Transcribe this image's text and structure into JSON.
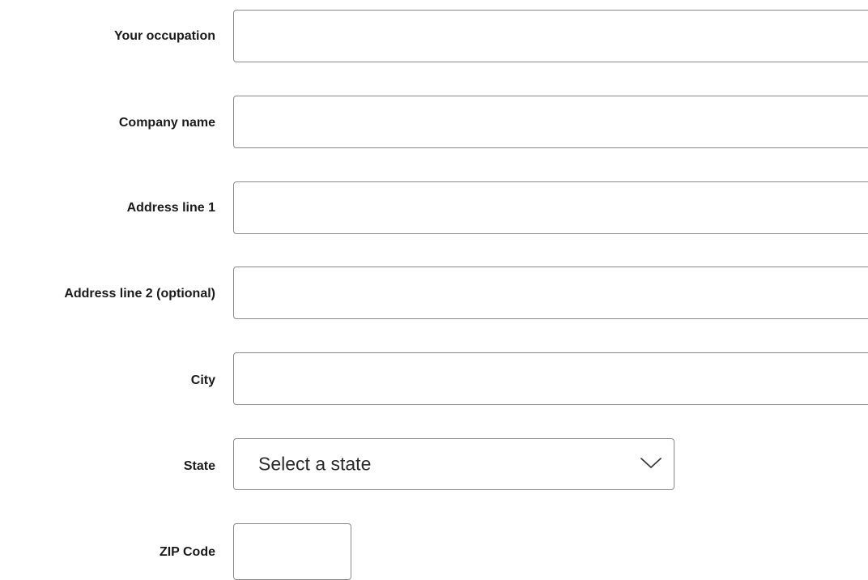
{
  "form": {
    "occupation": {
      "label": "Your occupation",
      "value": ""
    },
    "company": {
      "label": "Company name",
      "value": ""
    },
    "address1": {
      "label": "Address line 1",
      "value": ""
    },
    "address2": {
      "label": "Address line 2 (optional)",
      "value": ""
    },
    "city": {
      "label": "City",
      "value": ""
    },
    "state": {
      "label": "State",
      "selected": "Select a state",
      "icon": "chevron-down-icon"
    },
    "zip": {
      "label": "ZIP Code",
      "value": ""
    }
  },
  "colors": {
    "border": "#8a8a8a",
    "text": "#1a1a1a",
    "background": "#ffffff"
  }
}
